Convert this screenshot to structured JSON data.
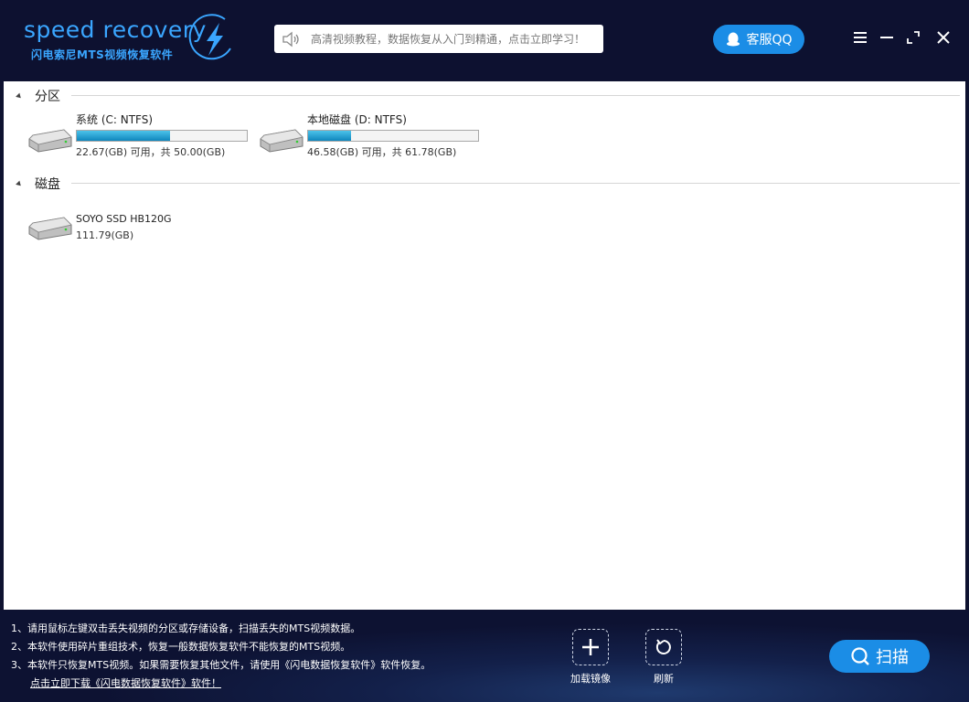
{
  "header": {
    "logo_text": "speed recovery",
    "logo_subtitle": "闪电索尼MTS视频恢复软件",
    "notice_text": "高清视频教程，数据恢复从入门到精通，点击立即学习！",
    "qq_label": "客服QQ"
  },
  "sections": {
    "partition_title": "分区",
    "disk_title": "磁盘"
  },
  "partitions": [
    {
      "name": "系统 (C: NTFS)",
      "usage": "22.67(GB) 可用，共 50.00(GB)",
      "used_fraction": 0.55
    },
    {
      "name": "本地磁盘 (D: NTFS)",
      "usage": "46.58(GB) 可用，共 61.78(GB)",
      "used_fraction": 0.25
    }
  ],
  "disks": [
    {
      "name": "SOYO SSD HB120G",
      "size": "111.79(GB)"
    }
  ],
  "footer": {
    "tips": [
      "1、请用鼠标左键双击丢失视频的分区或存储设备，扫描丢失的MTS视频数据。",
      "2、本软件使用碎片重组技术，恢复一般数据恢复软件不能恢复的MTS视频。",
      "3、本软件只恢复MTS视频。如果需要恢复其他文件，请使用《闪电数据恢复软件》软件恢复。"
    ],
    "download_link": "点击立即下载《闪电数据恢复软件》软件！",
    "load_image_label": "加载镜像",
    "refresh_label": "刷新",
    "scan_label": "扫描"
  },
  "colors": {
    "accent": "#1b8de6",
    "background": "#0d1130",
    "bar_fill": "#1694c8"
  }
}
